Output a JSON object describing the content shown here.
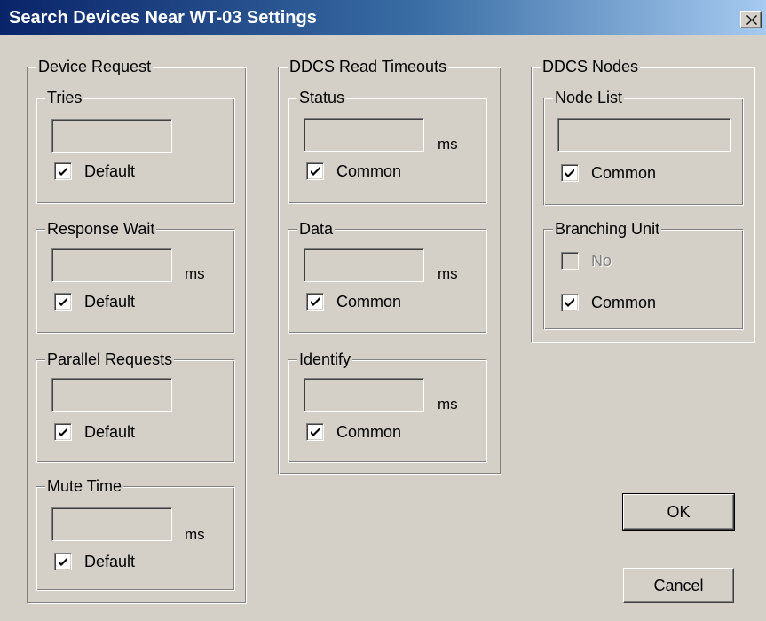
{
  "window": {
    "title": "Search Devices Near WT-03 Settings",
    "close_icon": "close-icon"
  },
  "device_request": {
    "label": "Device Request",
    "tries": {
      "label": "Tries",
      "value": "",
      "checkbox_label": "Default",
      "checked": true
    },
    "response_wait": {
      "label": "Response Wait",
      "value": "",
      "unit": "ms",
      "checkbox_label": "Default",
      "checked": true
    },
    "parallel_requests": {
      "label": "Parallel Requests",
      "value": "",
      "checkbox_label": "Default",
      "checked": true
    },
    "mute_time": {
      "label": "Mute Time",
      "value": "",
      "unit": "ms",
      "checkbox_label": "Default",
      "checked": true
    }
  },
  "ddcs_read_timeouts": {
    "label": "DDCS Read Timeouts",
    "status": {
      "label": "Status",
      "value": "",
      "unit": "ms",
      "checkbox_label": "Common",
      "checked": true
    },
    "data": {
      "label": "Data",
      "value": "",
      "unit": "ms",
      "checkbox_label": "Common",
      "checked": true
    },
    "identify": {
      "label": "Identify",
      "value": "",
      "unit": "ms",
      "checkbox_label": "Common",
      "checked": true
    }
  },
  "ddcs_nodes": {
    "label": "DDCS Nodes",
    "node_list": {
      "label": "Node List",
      "value": "",
      "checkbox_label": "Common",
      "checked": true
    },
    "branching_unit": {
      "label": "Branching Unit",
      "no_label": "No",
      "no_checked": false,
      "no_disabled": true,
      "checkbox_label": "Common",
      "checked": true
    }
  },
  "buttons": {
    "ok": "OK",
    "cancel": "Cancel"
  }
}
